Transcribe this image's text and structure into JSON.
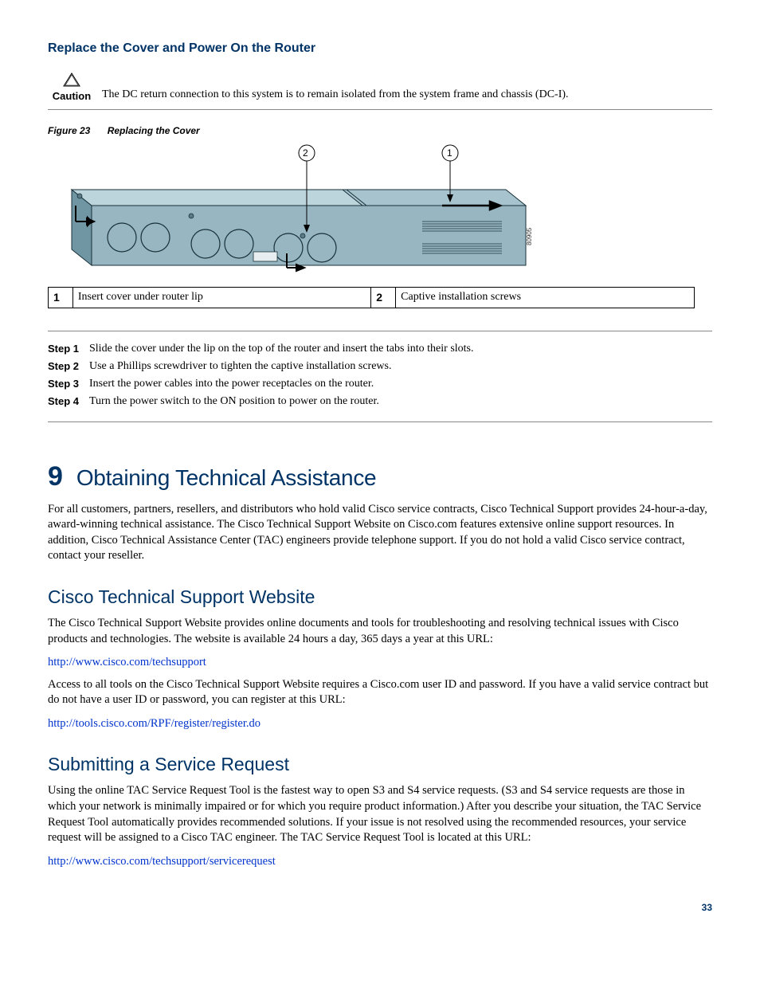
{
  "section": {
    "title": "Replace the Cover and Power On the Router"
  },
  "caution": {
    "label": "Caution",
    "text": "The DC return connection to this system is to remain isolated from the system frame and chassis (DC-I)."
  },
  "figure": {
    "label": "Figure 23",
    "title": "Replacing the Cover",
    "artnum": "80905",
    "callouts": [
      {
        "num": "1",
        "desc": "Insert cover under router lip"
      },
      {
        "num": "2",
        "desc": "Captive installation screws"
      }
    ],
    "balloon1": "1",
    "balloon2": "2"
  },
  "steps": [
    {
      "label": "Step 1",
      "text": "Slide the cover under the lip on the top of the router and insert the tabs into their slots."
    },
    {
      "label": "Step 2",
      "text": "Use a Phillips screwdriver to tighten the captive installation screws."
    },
    {
      "label": "Step 3",
      "text": "Insert the power cables into the power receptacles on the router."
    },
    {
      "label": "Step 4",
      "text": "Turn the power switch to the ON position to power on the router."
    }
  ],
  "chapter": {
    "num": "9",
    "title": "Obtaining Technical Assistance",
    "intro": "For all customers, partners, resellers, and distributors who hold valid Cisco service contracts, Cisco Technical Support provides 24-hour-a-day, award-winning technical assistance. The Cisco Technical Support Website on Cisco.com features extensive online support resources. In addition, Cisco Technical Assistance Center (TAC) engineers provide telephone support. If you do not hold a valid Cisco service contract, contact your reseller."
  },
  "sub1": {
    "title": "Cisco Technical Support Website",
    "p1": "The Cisco Technical Support Website provides online documents and tools for troubleshooting and resolving technical issues with Cisco products and technologies. The website is available 24 hours a day, 365 days a year at this URL:",
    "link1": "http://www.cisco.com/techsupport",
    "p2": "Access to all tools on the Cisco Technical Support Website requires a Cisco.com user ID and password. If you have a valid service contract but do not have a user ID or password, you can register at this URL:",
    "link2": "http://tools.cisco.com/RPF/register/register.do"
  },
  "sub2": {
    "title": "Submitting a Service Request",
    "p1": "Using the online TAC Service Request Tool is the fastest way to open S3 and S4 service requests. (S3 and S4 service requests are those in which your network is minimally impaired or for which you require product information.) After you describe your situation, the TAC Service Request Tool automatically provides recommended solutions. If your issue is not resolved using the recommended resources, your service request will be assigned to a Cisco TAC engineer. The TAC Service Request Tool is located at this URL:",
    "link1": "http://www.cisco.com/techsupport/servicerequest"
  },
  "page": "33"
}
